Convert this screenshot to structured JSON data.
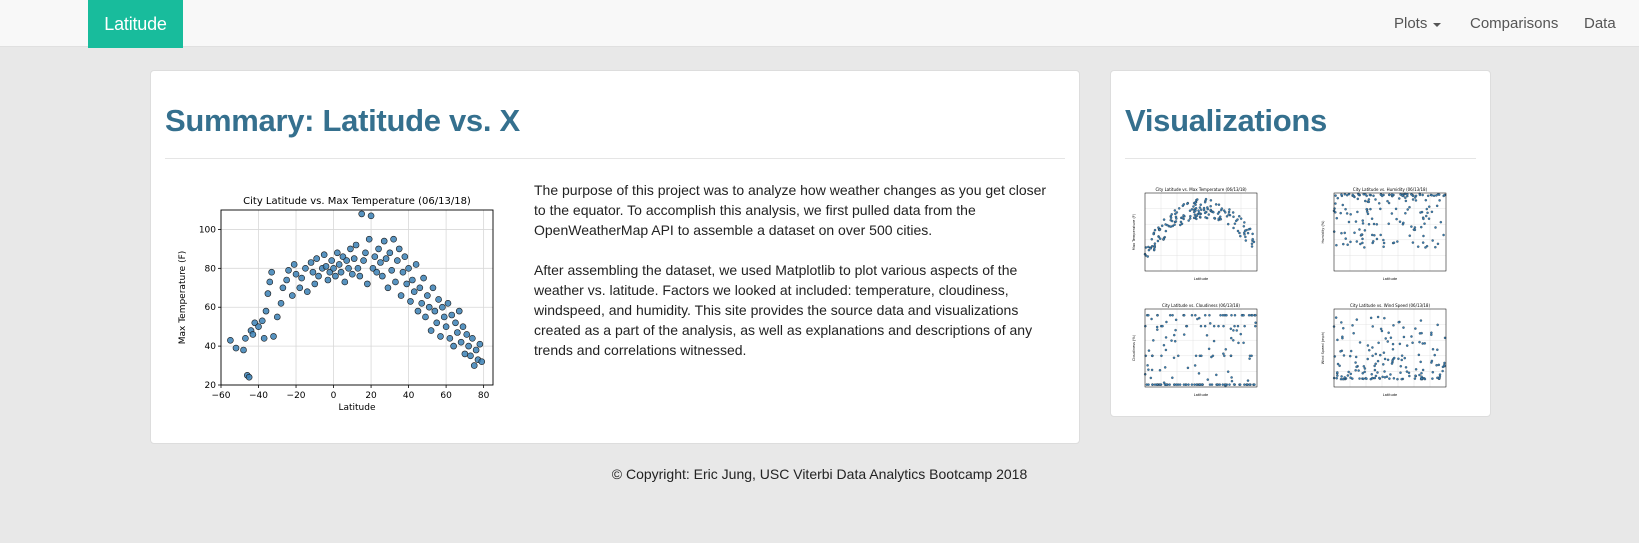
{
  "navbar": {
    "brand": "Latitude",
    "items": [
      {
        "label": "Plots",
        "dropdown": true
      },
      {
        "label": "Comparisons",
        "dropdown": false
      },
      {
        "label": "Data",
        "dropdown": false
      }
    ]
  },
  "summary": {
    "title": "Summary: Latitude vs. X",
    "paragraph1": "The purpose of this project was to analyze how weather changes as you get closer to the equator. To accomplish this analysis, we first pulled data from the OpenWeatherMap API to assemble a dataset on over 500 cities.",
    "paragraph2": "After assembling the dataset, we used Matplotlib to plot various aspects of the weather vs. latitude. Factors we looked at included: temperature, cloudiness, windspeed, and humidity. This site provides the source data and visualizations created as a part of the analysis, as well as explanations and descriptions of any trends and correlations witnessed."
  },
  "visualizations": {
    "title": "Visualizations"
  },
  "footer": {
    "text": "© Copyright: Eric Jung, USC Viterbi Data Analytics Bootcamp 2018"
  },
  "colors": {
    "brand": "#18bc9c",
    "heading": "#35708e",
    "marker": "#3a80b5"
  },
  "chart_data": [
    {
      "type": "scatter",
      "title": "City Latitude vs. Max Temperature (06/13/18)",
      "xlabel": "Latitude",
      "ylabel": "Max Temperature (F)",
      "xlim": [
        -60,
        85
      ],
      "ylim": [
        20,
        110
      ],
      "xticks": [
        -60,
        -40,
        -20,
        0,
        20,
        40,
        60,
        80
      ],
      "yticks": [
        20,
        40,
        60,
        80,
        100
      ],
      "grid": true,
      "points": [
        [
          -55,
          43
        ],
        [
          -52,
          39
        ],
        [
          -48,
          38
        ],
        [
          -47,
          44
        ],
        [
          -46,
          25
        ],
        [
          -45,
          24
        ],
        [
          -44,
          48
        ],
        [
          -43,
          46
        ],
        [
          -42,
          52
        ],
        [
          -40,
          50
        ],
        [
          -38,
          53
        ],
        [
          -37,
          44
        ],
        [
          -36,
          58
        ],
        [
          -35,
          67
        ],
        [
          -34,
          73
        ],
        [
          -33,
          78
        ],
        [
          -32,
          45
        ],
        [
          -30,
          55
        ],
        [
          -28,
          62
        ],
        [
          -27,
          70
        ],
        [
          -25,
          74
        ],
        [
          -24,
          79
        ],
        [
          -22,
          66
        ],
        [
          -21,
          82
        ],
        [
          -20,
          77
        ],
        [
          -18,
          70
        ],
        [
          -17,
          75
        ],
        [
          -15,
          80
        ],
        [
          -14,
          68
        ],
        [
          -12,
          83
        ],
        [
          -11,
          78
        ],
        [
          -10,
          72
        ],
        [
          -9,
          85
        ],
        [
          -8,
          76
        ],
        [
          -6,
          80
        ],
        [
          -5,
          87
        ],
        [
          -4,
          81
        ],
        [
          -3,
          74
        ],
        [
          -2,
          78
        ],
        [
          -1,
          84
        ],
        [
          0,
          80
        ],
        [
          1,
          76
        ],
        [
          2,
          88
        ],
        [
          3,
          82
        ],
        [
          4,
          78
        ],
        [
          5,
          86
        ],
        [
          6,
          73
        ],
        [
          7,
          84
        ],
        [
          8,
          80
        ],
        [
          9,
          90
        ],
        [
          10,
          77
        ],
        [
          11,
          85
        ],
        [
          12,
          92
        ],
        [
          13,
          80
        ],
        [
          14,
          76
        ],
        [
          15,
          108
        ],
        [
          16,
          84
        ],
        [
          17,
          88
        ],
        [
          18,
          72
        ],
        [
          19,
          95
        ],
        [
          20,
          107
        ],
        [
          21,
          80
        ],
        [
          22,
          86
        ],
        [
          23,
          78
        ],
        [
          24,
          90
        ],
        [
          25,
          83
        ],
        [
          26,
          76
        ],
        [
          27,
          94
        ],
        [
          28,
          85
        ],
        [
          29,
          70
        ],
        [
          30,
          88
        ],
        [
          31,
          79
        ],
        [
          32,
          95
        ],
        [
          33,
          73
        ],
        [
          34,
          84
        ],
        [
          35,
          90
        ],
        [
          36,
          66
        ],
        [
          37,
          78
        ],
        [
          38,
          86
        ],
        [
          39,
          72
        ],
        [
          40,
          80
        ],
        [
          41,
          63
        ],
        [
          42,
          74
        ],
        [
          43,
          68
        ],
        [
          44,
          82
        ],
        [
          45,
          58
        ],
        [
          46,
          70
        ],
        [
          47,
          62
        ],
        [
          48,
          75
        ],
        [
          49,
          55
        ],
        [
          50,
          66
        ],
        [
          51,
          60
        ],
        [
          52,
          48
        ],
        [
          53,
          70
        ],
        [
          54,
          58
        ],
        [
          55,
          52
        ],
        [
          56,
          64
        ],
        [
          57,
          45
        ],
        [
          58,
          60
        ],
        [
          59,
          55
        ],
        [
          60,
          50
        ],
        [
          61,
          62
        ],
        [
          62,
          44
        ],
        [
          63,
          56
        ],
        [
          64,
          40
        ],
        [
          65,
          52
        ],
        [
          66,
          47
        ],
        [
          67,
          58
        ],
        [
          68,
          42
        ],
        [
          69,
          50
        ],
        [
          70,
          36
        ],
        [
          71,
          46
        ],
        [
          72,
          40
        ],
        [
          73,
          35
        ],
        [
          74,
          44
        ],
        [
          75,
          30
        ],
        [
          76,
          38
        ],
        [
          77,
          33
        ],
        [
          78,
          41
        ],
        [
          79,
          32
        ]
      ]
    },
    {
      "type": "scatter",
      "title": "City Latitude vs. Max Temperature (06/13/18)",
      "xlabel": "Latitude",
      "ylabel": "Max Temperature (F)"
    },
    {
      "type": "scatter",
      "title": "City Latitude vs. Humidity (06/13/18)",
      "xlabel": "Latitude",
      "ylabel": "Humidity (%)"
    },
    {
      "type": "scatter",
      "title": "City Latitude vs. Cloudiness (06/13/18)",
      "xlabel": "Latitude",
      "ylabel": "Cloudiness (%)"
    },
    {
      "type": "scatter",
      "title": "City Latitude vs. Wind Speed (06/13/18)",
      "xlabel": "Latitude",
      "ylabel": "Wind Speed (mph)"
    }
  ]
}
